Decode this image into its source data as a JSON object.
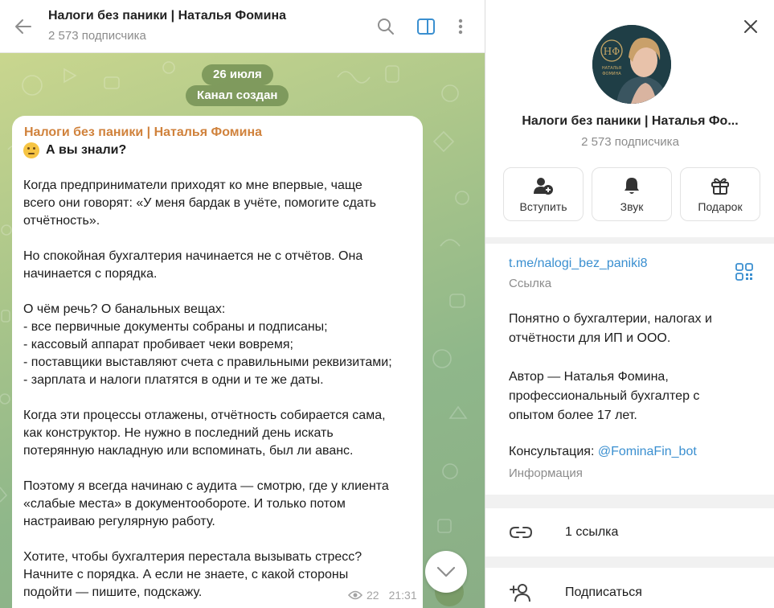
{
  "chat": {
    "title": "Налоги без паники | Наталья Фомина",
    "subscribers": "2 573 подписчика",
    "date_pill": "26 июля",
    "service_pill": "Канал создан",
    "message": {
      "author": "Налоги без паники | Наталья Фомина",
      "heading": "А вы знали?",
      "paragraphs": [
        [
          "Когда предприниматели приходят ко мне впервые, чаще",
          "всего они говорят: «У меня бардак в учёте, помогите сдать",
          "отчётность»."
        ],
        [
          "Но спокойная бухгалтерия начинается не с отчётов. Она",
          "начинается с порядка."
        ],
        [
          "О чём речь? О банальных вещах:",
          "- все первичные документы собраны и подписаны;",
          "- кассовый аппарат пробивает чеки вовремя;",
          "- поставщики выставляют счета с правильными реквизитами;",
          "- зарплата и налоги платятся в одни и те же даты."
        ],
        [
          "Когда эти процессы отлажены, отчётность собирается сама,",
          "как конструктор. Не нужно в последний день искать",
          "потерянную накладную или вспоминать, был ли аванс."
        ],
        [
          "Поэтому я всегда начинаю с аудита — смотрю, где у клиента",
          "«слабые места» в документообороте. И только потом",
          "настраиваю регулярную работу."
        ],
        [
          "Хотите, чтобы бухгалтерия перестала вызывать стресс?",
          "Начните с порядка. А если не знаете, с какой стороны",
          "подойти — пишите, подскажу."
        ]
      ],
      "views": "22",
      "time": "21:31"
    }
  },
  "info": {
    "title": "Налоги без паники | Наталья Фо...",
    "subscribers": "2 573 подписчика",
    "avatar_logo": "НФ",
    "avatar_caption_1": "НАТАЛЬЯ",
    "avatar_caption_2": "ФОМИНА",
    "actions": [
      {
        "label": "Вступить",
        "icon": "add-user-icon"
      },
      {
        "label": "Звук",
        "icon": "bell-icon"
      },
      {
        "label": "Подарок",
        "icon": "gift-icon"
      }
    ],
    "link": "t.me/nalogi_bez_paniki8",
    "link_label": "Ссылка",
    "description": [
      [
        "Понятно о бухгалтерии, налогах и",
        "отчётности для ИП и ООО."
      ],
      [
        "Автор — Наталья Фомина,",
        "профессиональный бухгалтер с",
        "опытом более 17 лет."
      ]
    ],
    "consult_prefix": "Консультация: ",
    "consult_link": "@FominaFin_bot",
    "info_label": "Информация",
    "links_row": "1 ссылка",
    "subscribe_row": "Подписаться"
  },
  "colors": {
    "accent": "#3a8fd0",
    "author": "#d0823c",
    "chat_bg": "#a9c58a"
  }
}
